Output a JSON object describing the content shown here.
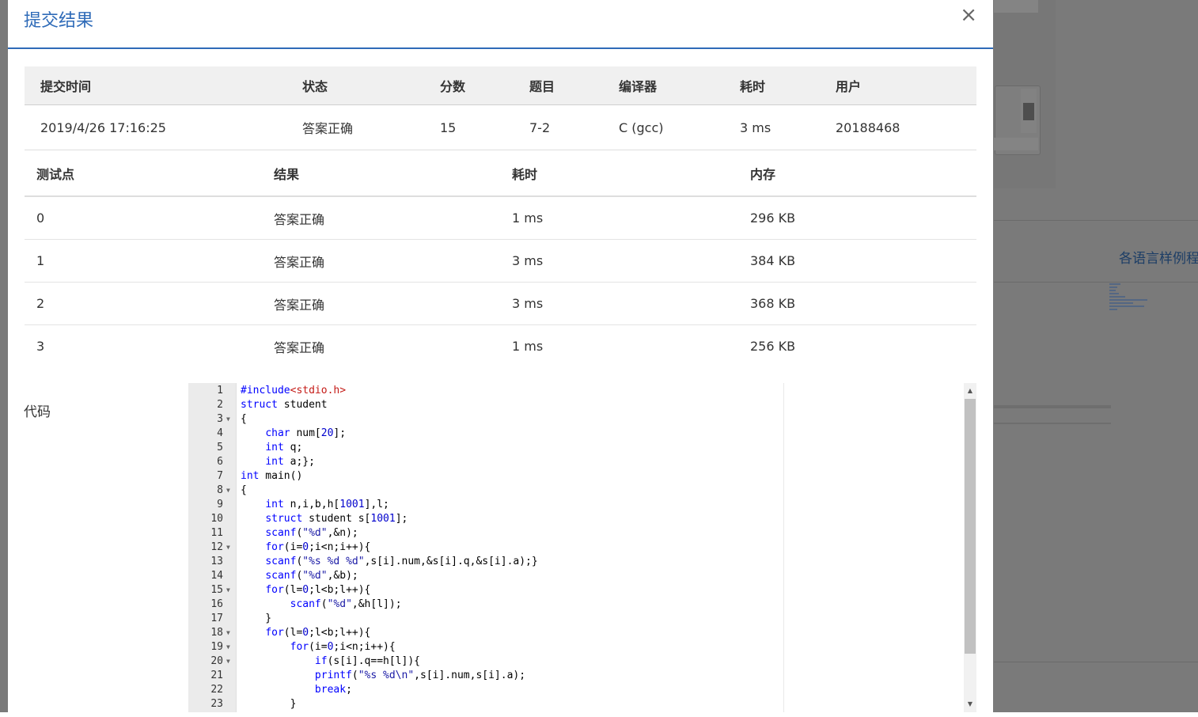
{
  "modal": {
    "title": "提交结果",
    "close_label": "×"
  },
  "summary": {
    "headers": [
      "提交时间",
      "状态",
      "分数",
      "题目",
      "编译器",
      "耗时",
      "用户"
    ],
    "row": {
      "time": "2019/4/26 17:16:25",
      "status": "答案正确",
      "score": "15",
      "problem": "7-2",
      "compiler": "C (gcc)",
      "elapsed": "3 ms",
      "user": "20188468"
    }
  },
  "cases": {
    "headers": [
      "测试点",
      "结果",
      "耗时",
      "内存"
    ],
    "rows": [
      {
        "id": "0",
        "result": "答案正确",
        "time": "1 ms",
        "memory": "296 KB"
      },
      {
        "id": "1",
        "result": "答案正确",
        "time": "3 ms",
        "memory": "384 KB"
      },
      {
        "id": "2",
        "result": "答案正确",
        "time": "3 ms",
        "memory": "368 KB"
      },
      {
        "id": "3",
        "result": "答案正确",
        "time": "1 ms",
        "memory": "256 KB"
      }
    ]
  },
  "code": {
    "label": "代码",
    "lines": [
      {
        "n": "1",
        "fold": false,
        "html": "<span class=\"kw\">#include</span><span class=\"inc\">&lt;stdio.h&gt;</span>"
      },
      {
        "n": "2",
        "fold": false,
        "html": "<span class=\"kw\">struct</span> student"
      },
      {
        "n": "3",
        "fold": true,
        "html": "{"
      },
      {
        "n": "4",
        "fold": false,
        "html": "    <span class=\"kw\">char</span> num[<span class=\"num\">20</span>];"
      },
      {
        "n": "5",
        "fold": false,
        "html": "    <span class=\"kw\">int</span> q;"
      },
      {
        "n": "6",
        "fold": false,
        "html": "    <span class=\"kw\">int</span> a;};"
      },
      {
        "n": "7",
        "fold": false,
        "html": "<span class=\"kw\">int</span> main()"
      },
      {
        "n": "8",
        "fold": true,
        "html": "{"
      },
      {
        "n": "9",
        "fold": false,
        "html": "    <span class=\"kw\">int</span> n,i,b,h[<span class=\"num\">1001</span>],l;"
      },
      {
        "n": "10",
        "fold": false,
        "html": "    <span class=\"kw\">struct</span> student s[<span class=\"num\">1001</span>];"
      },
      {
        "n": "11",
        "fold": false,
        "html": "    <span class=\"kw\">scanf</span>(<span class=\"str\">\"%d\"</span>,&amp;n);"
      },
      {
        "n": "12",
        "fold": true,
        "html": "    <span class=\"kw\">for</span>(i=<span class=\"num\">0</span>;i&lt;n;i++){"
      },
      {
        "n": "13",
        "fold": false,
        "html": "    <span class=\"kw\">scanf</span>(<span class=\"str\">\"%s %d %d\"</span>,s[i].num,&amp;s[i].q,&amp;s[i].a);}"
      },
      {
        "n": "14",
        "fold": false,
        "html": "    <span class=\"kw\">scanf</span>(<span class=\"str\">\"%d\"</span>,&amp;b);"
      },
      {
        "n": "15",
        "fold": true,
        "html": "    <span class=\"kw\">for</span>(l=<span class=\"num\">0</span>;l&lt;b;l++){"
      },
      {
        "n": "16",
        "fold": false,
        "html": "        <span class=\"kw\">scanf</span>(<span class=\"str\">\"%d\"</span>,&amp;h[l]);"
      },
      {
        "n": "17",
        "fold": false,
        "html": "    }"
      },
      {
        "n": "18",
        "fold": true,
        "html": "    <span class=\"kw\">for</span>(l=<span class=\"num\">0</span>;l&lt;b;l++){"
      },
      {
        "n": "19",
        "fold": true,
        "html": "        <span class=\"kw\">for</span>(i=<span class=\"num\">0</span>;i&lt;n;i++){"
      },
      {
        "n": "20",
        "fold": true,
        "html": "            <span class=\"kw\">if</span>(s[i].q==h[l]){"
      },
      {
        "n": "21",
        "fold": false,
        "html": "            <span class=\"kw\">printf</span>(<span class=\"str\">\"%s %d\\n\"</span>,s[i].num,s[i].a);"
      },
      {
        "n": "22",
        "fold": false,
        "html": "            <span class=\"kw\">break</span>;"
      },
      {
        "n": "23",
        "fold": false,
        "html": "        }"
      }
    ]
  },
  "background": {
    "link_text": "各语言样例程"
  }
}
